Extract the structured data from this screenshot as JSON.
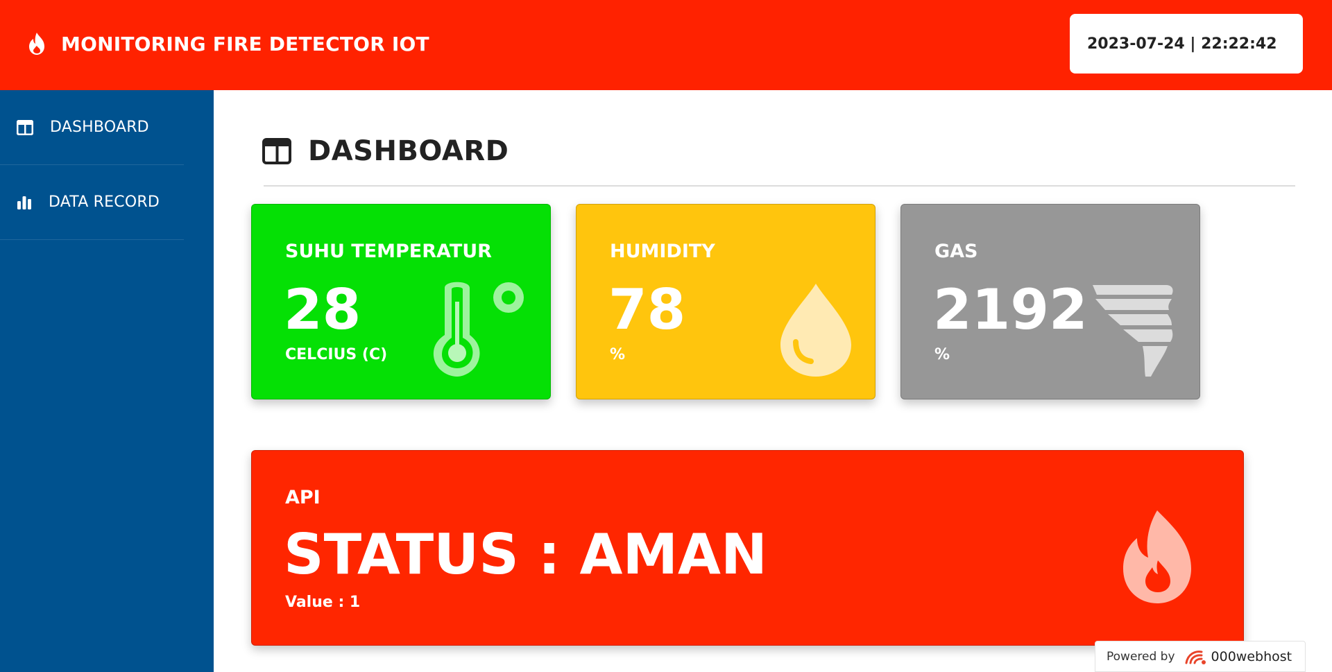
{
  "header": {
    "title": "MONITORING FIRE DETECTOR IOT",
    "datetime": "2023-07-24 | 22:22:42"
  },
  "sidebar": {
    "items": [
      {
        "label": "DASHBOARD",
        "icon": "dashboard-icon"
      },
      {
        "label": "DATA RECORD",
        "icon": "bar-chart-icon"
      }
    ]
  },
  "main": {
    "page_title": "DASHBOARD",
    "cards": [
      {
        "title": "SUHU TEMPERATUR",
        "value": "28",
        "unit": "CELCIUS (C)",
        "icon": "thermometer-icon",
        "color": "#05e005"
      },
      {
        "title": "HUMIDITY",
        "value": "78",
        "unit": "%",
        "icon": "water-drop-icon",
        "color": "#ffc50d"
      },
      {
        "title": "GAS",
        "value": "2192",
        "unit": "%",
        "icon": "tornado-icon",
        "color": "#979797"
      }
    ],
    "status": {
      "label": "API",
      "status_text": "STATUS : AMAN",
      "value_text": "Value : 1",
      "icon": "fire-icon",
      "color": "#ff2600"
    }
  },
  "footer": {
    "powered_by": "Powered by",
    "brand": "000webhost"
  },
  "colors": {
    "header": "#ff2200",
    "sidebar": "#00528f"
  }
}
